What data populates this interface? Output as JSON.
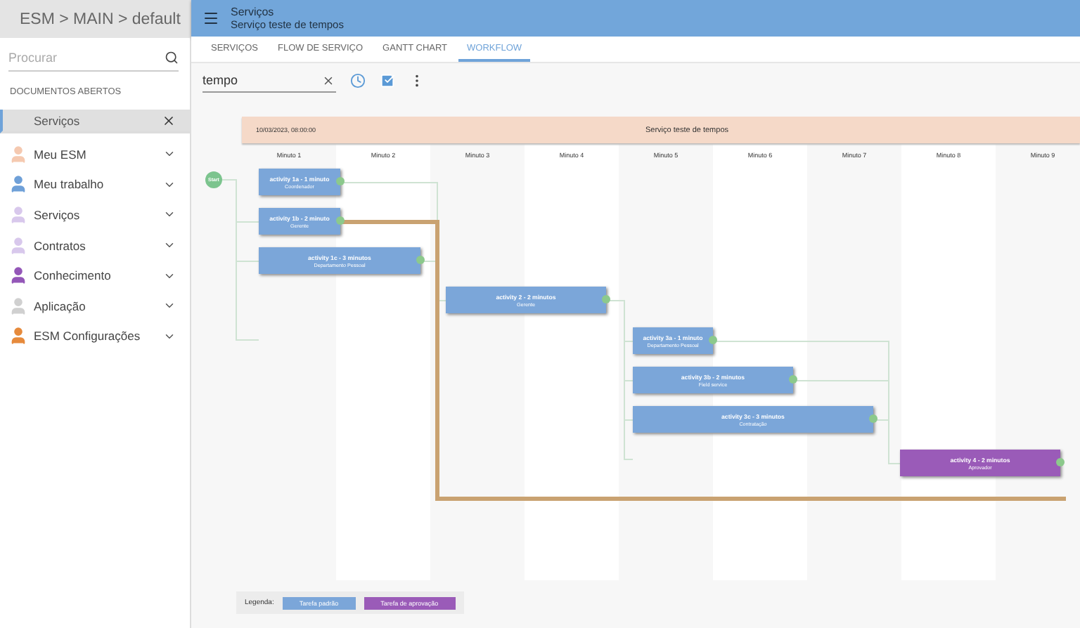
{
  "sidebar": {
    "breadcrumb": "ESM > MAIN > default",
    "search": {
      "placeholder": "Procurar"
    },
    "open_documents_title": "DOCUMENTOS ABERTOS",
    "open_documents": [
      {
        "label": "Serviços",
        "selected": true
      }
    ],
    "menu": [
      {
        "label": "Meu ESM",
        "color": "#f5c9b0"
      },
      {
        "label": "Meu trabalho",
        "color": "#6fa0d8"
      },
      {
        "label": "Serviços",
        "color": "#d8c8ec"
      },
      {
        "label": "Contratos",
        "color": "#d8c8ec"
      },
      {
        "label": "Conhecimento",
        "color": "#9457b8"
      },
      {
        "label": "Aplicação",
        "color": "#d0d0d0"
      },
      {
        "label": "ESM Configurações",
        "color": "#e68a3c"
      }
    ]
  },
  "header": {
    "title": "Serviços",
    "subtitle": "Serviço teste de tempos"
  },
  "tabs": [
    {
      "label": "SERVIÇOS",
      "selected": false
    },
    {
      "label": "FLOW DE SERVIÇO",
      "selected": false
    },
    {
      "label": "GANTT CHART",
      "selected": false
    },
    {
      "label": "WORKFLOW",
      "selected": true
    }
  ],
  "toolbar": {
    "search": {
      "value": "tempo"
    }
  },
  "workflow": {
    "date": "10/03/2023, 08:00:00",
    "title": "Serviço teste de tempos",
    "start_label": "Start",
    "columns": [
      "Minuto 1",
      "Minuto 2",
      "Minuto 3",
      "Minuto 4",
      "Minuto 5",
      "Minuto 6",
      "Minuto 7",
      "Minuto 8",
      "Minuto 9"
    ],
    "nodes": [
      {
        "title": "activity 1a - 1 minuto",
        "role": "Coordenador",
        "kind": "task"
      },
      {
        "title": "activity 1b - 2 minuto",
        "role": "Gerente",
        "kind": "task"
      },
      {
        "title": "activity 1c - 3 minutos",
        "role": "Departamento Pessoal",
        "kind": "task"
      },
      {
        "title": "activity 2 - 2 minutos",
        "role": "Gerente",
        "kind": "task"
      },
      {
        "title": "activity 3a - 1 minuto",
        "role": "Departamento Pessoal",
        "kind": "task"
      },
      {
        "title": "activity 3b - 2 minutos",
        "role": "Field service",
        "kind": "task"
      },
      {
        "title": "activity 3c - 3 minutos",
        "role": "Contratação",
        "kind": "task"
      },
      {
        "title": "activity 4 - 2 minutos",
        "role": "Aprovador",
        "kind": "approval"
      }
    ],
    "legend": {
      "title": "Legenda:",
      "items": [
        {
          "label": "Tarefa padrão",
          "kind": "task"
        },
        {
          "label": "Tarefa de aprovação",
          "kind": "approval"
        }
      ]
    }
  }
}
